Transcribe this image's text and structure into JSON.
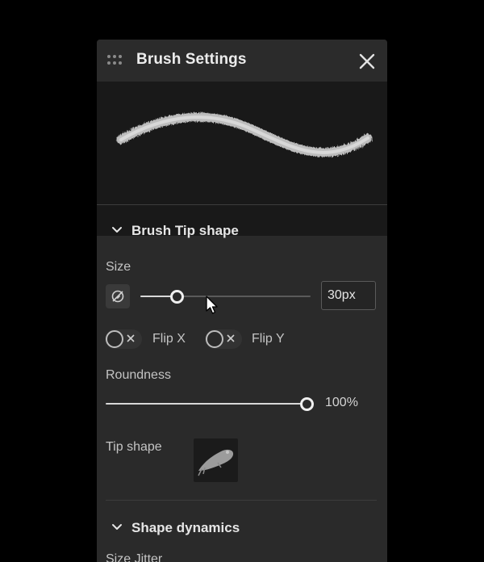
{
  "panel": {
    "title": "Brush Settings",
    "drag_handle_icon": "grip-dots-icon",
    "close_icon": "close-icon"
  },
  "tip_section": {
    "title": "Brush Tip shape",
    "expanded": true,
    "size": {
      "label": "Size",
      "value": "30px",
      "slider_fraction": 0.22,
      "pressure_icon": "pen-pressure-icon"
    },
    "flip_x": {
      "label": "Flip X",
      "on": false
    },
    "flip_y": {
      "label": "Flip Y",
      "on": false
    },
    "roundness": {
      "label": "Roundness",
      "value": "100%",
      "slider_fraction": 1.0
    },
    "tip_shape": {
      "label": "Tip shape",
      "icon": "brush-tip-thumbnail"
    }
  },
  "dynamics_section": {
    "title": "Shape dynamics",
    "expanded": true,
    "first_item": "Size Jitter"
  },
  "colors": {
    "panel_bg": "#2a2a2a",
    "preview_bg": "#191919",
    "page_bg": "#000000",
    "accent": "#efefef"
  }
}
